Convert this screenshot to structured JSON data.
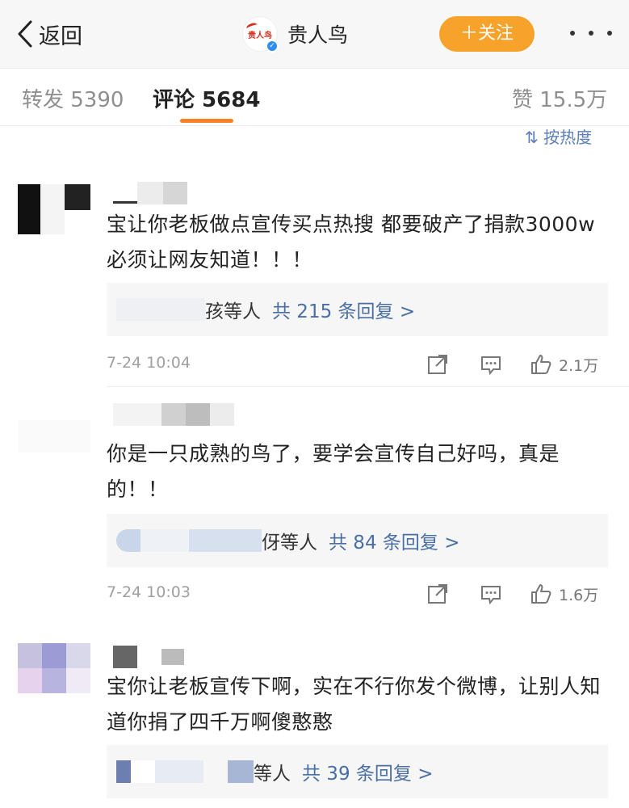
{
  "header": {
    "back_label": "返回",
    "account_name": "贵人鸟",
    "logo_text": "贵人鸟",
    "follow_label": "＋关注"
  },
  "tabs": {
    "repost": "转发 5390",
    "comment": "评论 5684",
    "likes": "赞 15.5万"
  },
  "sort_label": "按热度",
  "comments": [
    {
      "text": "宝让你老板做点宣传买点热搜  都要破产了捐款3000w必须让网友知道！！！",
      "reply_names": "孩等人",
      "reply_count": "共 215 条回复 >",
      "time": "7-24 10:04",
      "likes": "2.1万"
    },
    {
      "text": "你是一只成熟的鸟了，要学会宣传自己好吗，真是的！！",
      "reply_names": "伢等人",
      "reply_count": "共 84 条回复 >",
      "time": "7-24 10:03",
      "likes": "1.6万"
    },
    {
      "text": "宝你让老板宣传下啊，实在不行你发个微博，让别人知道你捐了四千万啊傻憨憨",
      "reply_names": "等人",
      "reply_count": "共 39 条回复 >"
    }
  ],
  "colors": {
    "accent_orange": "#f78123",
    "follow_button": "#f7a22b",
    "link_blue": "#4a6fa5",
    "reply_bg": "#f6f6f6"
  },
  "icons": [
    "chevron-left-icon",
    "more-icon",
    "sort-icon",
    "share-icon",
    "comment-icon",
    "like-icon",
    "verified-icon"
  ]
}
